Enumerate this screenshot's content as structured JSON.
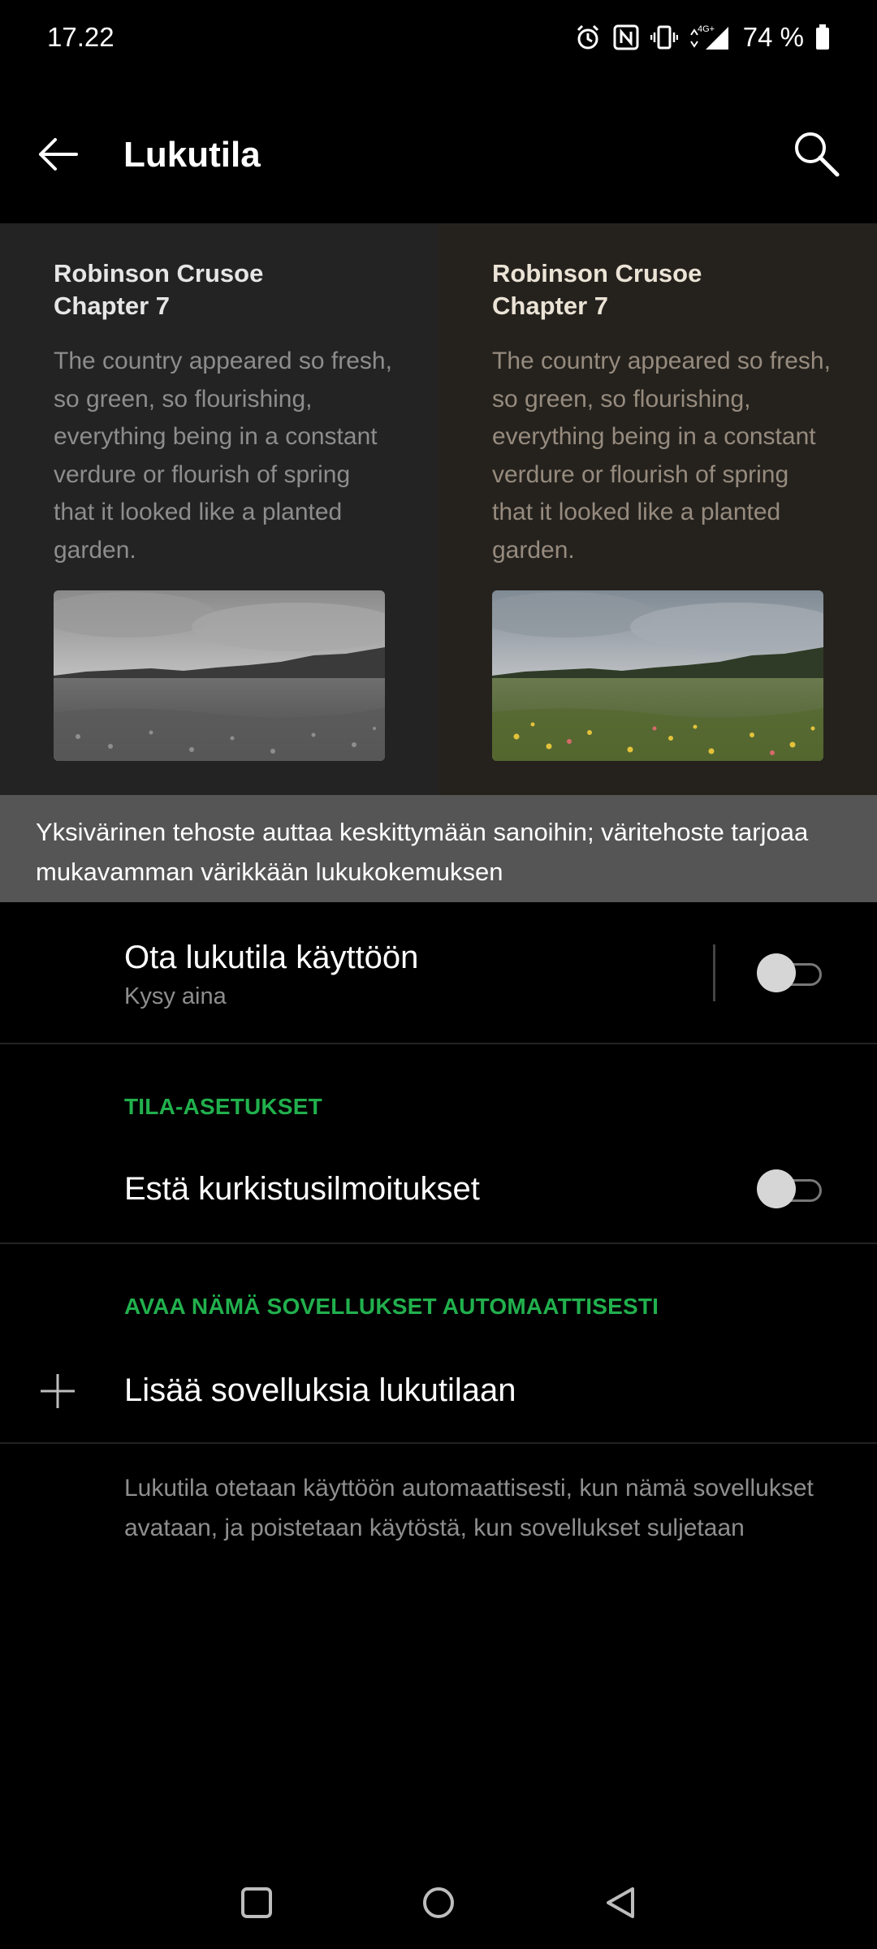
{
  "status": {
    "time": "17.22",
    "network": "4G+",
    "battery": "74 %",
    "icons": [
      "alarm-icon",
      "nfc-icon",
      "vibrate-icon",
      "signal-icon",
      "battery-icon"
    ]
  },
  "header": {
    "title": "Lukutila",
    "back_icon": "back-arrow-icon",
    "search_icon": "search-icon"
  },
  "preview": {
    "mono": {
      "heading_line1": "Robinson Crusoe",
      "heading_line2": "Chapter 7",
      "body": "The country appeared so fresh, so green, so flourishing, everything being in a constant verdure or flourish of spring that it looked like a planted garden."
    },
    "color": {
      "heading_line1": "Robinson Crusoe",
      "heading_line2": "Chapter 7",
      "body": "The country appeared so fresh, so green, so flourishing, everything being in a constant verdure or flourish of spring that it looked like a planted garden."
    }
  },
  "tip": "Yksivärinen tehoste auttaa keskittymään sanoihin; väritehoste tarjoaa mukavamman värikkään lukukokemuksen",
  "settings": {
    "enable": {
      "title": "Ota lukutila käyttöön",
      "subtitle": "Kysy aina",
      "on": false
    },
    "section_mode": "TILA-ASETUKSET",
    "block_peek": {
      "title": "Estä kurkistusilmoitukset",
      "on": false
    },
    "section_apps": "AVAA NÄMÄ SOVELLUKSET AUTOMAATTISESTI",
    "add_apps": {
      "title": "Lisää sovelluksia lukutilaan",
      "icon": "plus-icon"
    },
    "footnote": "Lukutila otetaan käyttöön automaattisesti, kun nämä sovellukset avataan, ja poistetaan käytöstä, kun sovellukset suljetaan"
  },
  "colors": {
    "accent": "#21b04d",
    "tip_background": "#555555",
    "background": "#000000"
  },
  "nav": [
    "recents-icon",
    "home-icon",
    "back-icon"
  ]
}
